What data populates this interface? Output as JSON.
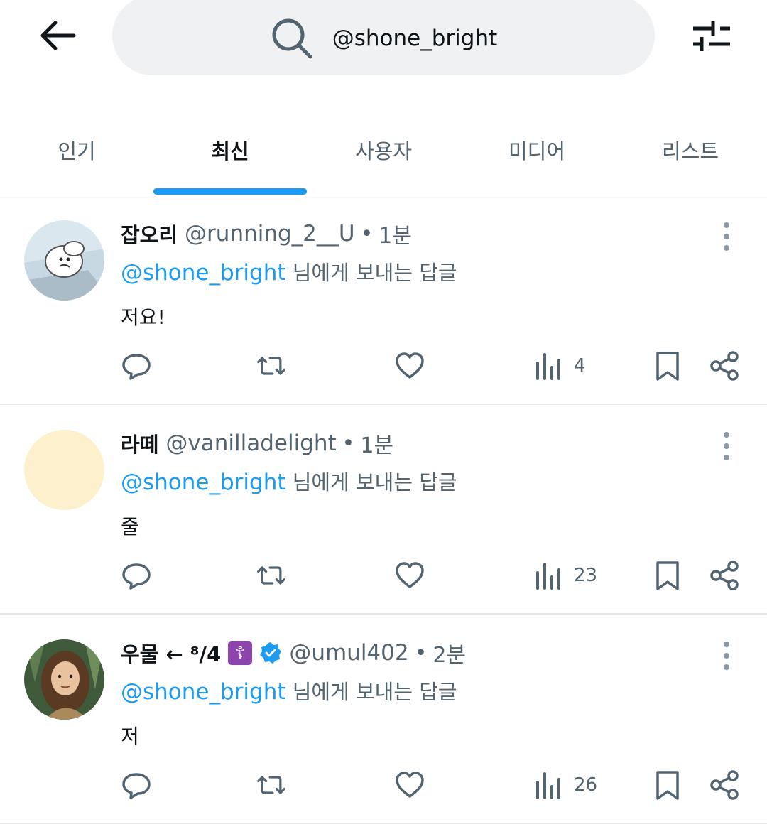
{
  "search": {
    "value": "@shone_bright"
  },
  "tabs": [
    {
      "label": "인기",
      "active": false
    },
    {
      "label": "최신",
      "active": true
    },
    {
      "label": "사용자",
      "active": false
    },
    {
      "label": "미디어",
      "active": false
    },
    {
      "label": "리스트",
      "active": false
    }
  ],
  "tweets": [
    {
      "display_name": "잡오리",
      "handle": "@running_2__U",
      "dot": "•",
      "time": "1분",
      "reply_mention": "@shone_bright",
      "reply_suffix": " 님에게 보내는 답글",
      "text": "저요!",
      "views": "4"
    },
    {
      "display_name": "라떼",
      "handle": "@vanilladelight",
      "dot": "•",
      "time": "1분",
      "reply_mention": "@shone_bright",
      "reply_suffix": " 님에게 보내는 답글",
      "text": "줄",
      "views": "23"
    },
    {
      "display_name": "우물 ← ⁸/4",
      "badge_emoji": "☦",
      "handle": "@umul402",
      "dot": "•",
      "time": "2분",
      "reply_mention": "@shone_bright",
      "reply_suffix": " 님에게 보내는 답글",
      "text": "저",
      "views": "26"
    }
  ],
  "colors": {
    "accent": "#1d9bf0",
    "secondary_text": "#536471",
    "divider": "#e6e9eb",
    "search_bg": "#eff1f2"
  },
  "icons": {
    "back": "arrow-left-icon",
    "search": "search-icon",
    "filter": "sliders-icon",
    "reply": "reply-icon",
    "retweet": "retweet-icon",
    "like": "heart-icon",
    "views": "views-icon",
    "bookmark": "bookmark-icon",
    "share": "share-icon",
    "more": "more-vertical-icon"
  }
}
